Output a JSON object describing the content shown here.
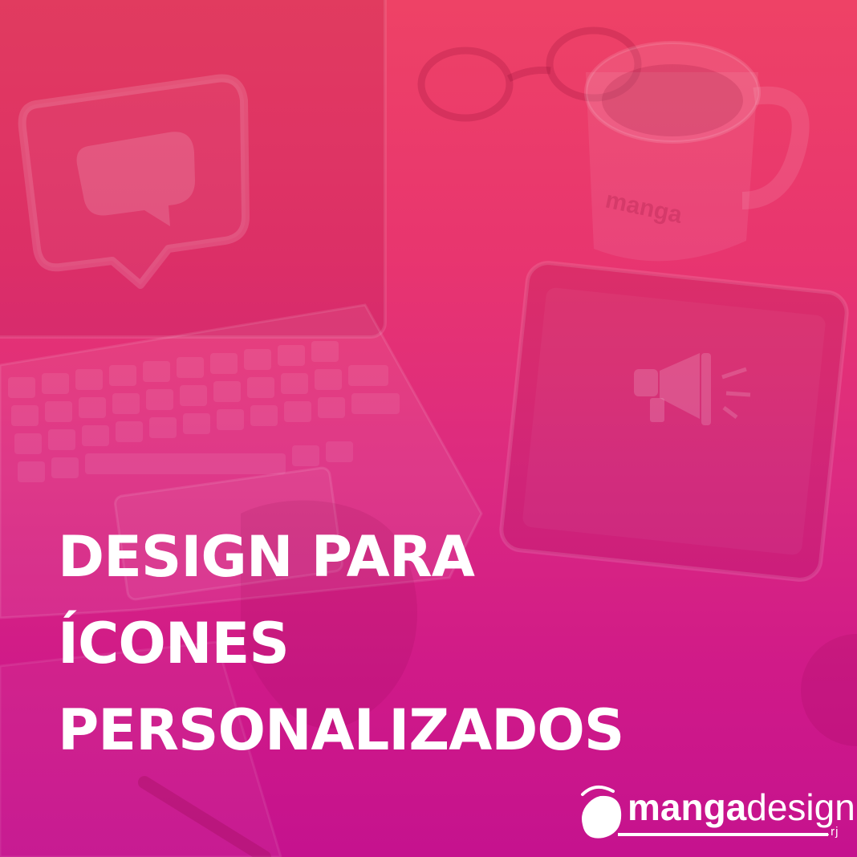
{
  "headline": {
    "line1": "DESIGN PARA",
    "line2": "ÍCONES",
    "line3": "PERSONALIZADOS"
  },
  "logo": {
    "word_bold": "manga",
    "word_light": "design",
    "suffix": ".rj"
  },
  "mug_print": "manga",
  "colors": {
    "gradient_top": "#ee4266",
    "gradient_bottom": "#c5128e",
    "text": "#ffffff"
  },
  "icons": [
    "speech-bubble-icon",
    "megaphone-icon",
    "mango-logo-icon"
  ]
}
